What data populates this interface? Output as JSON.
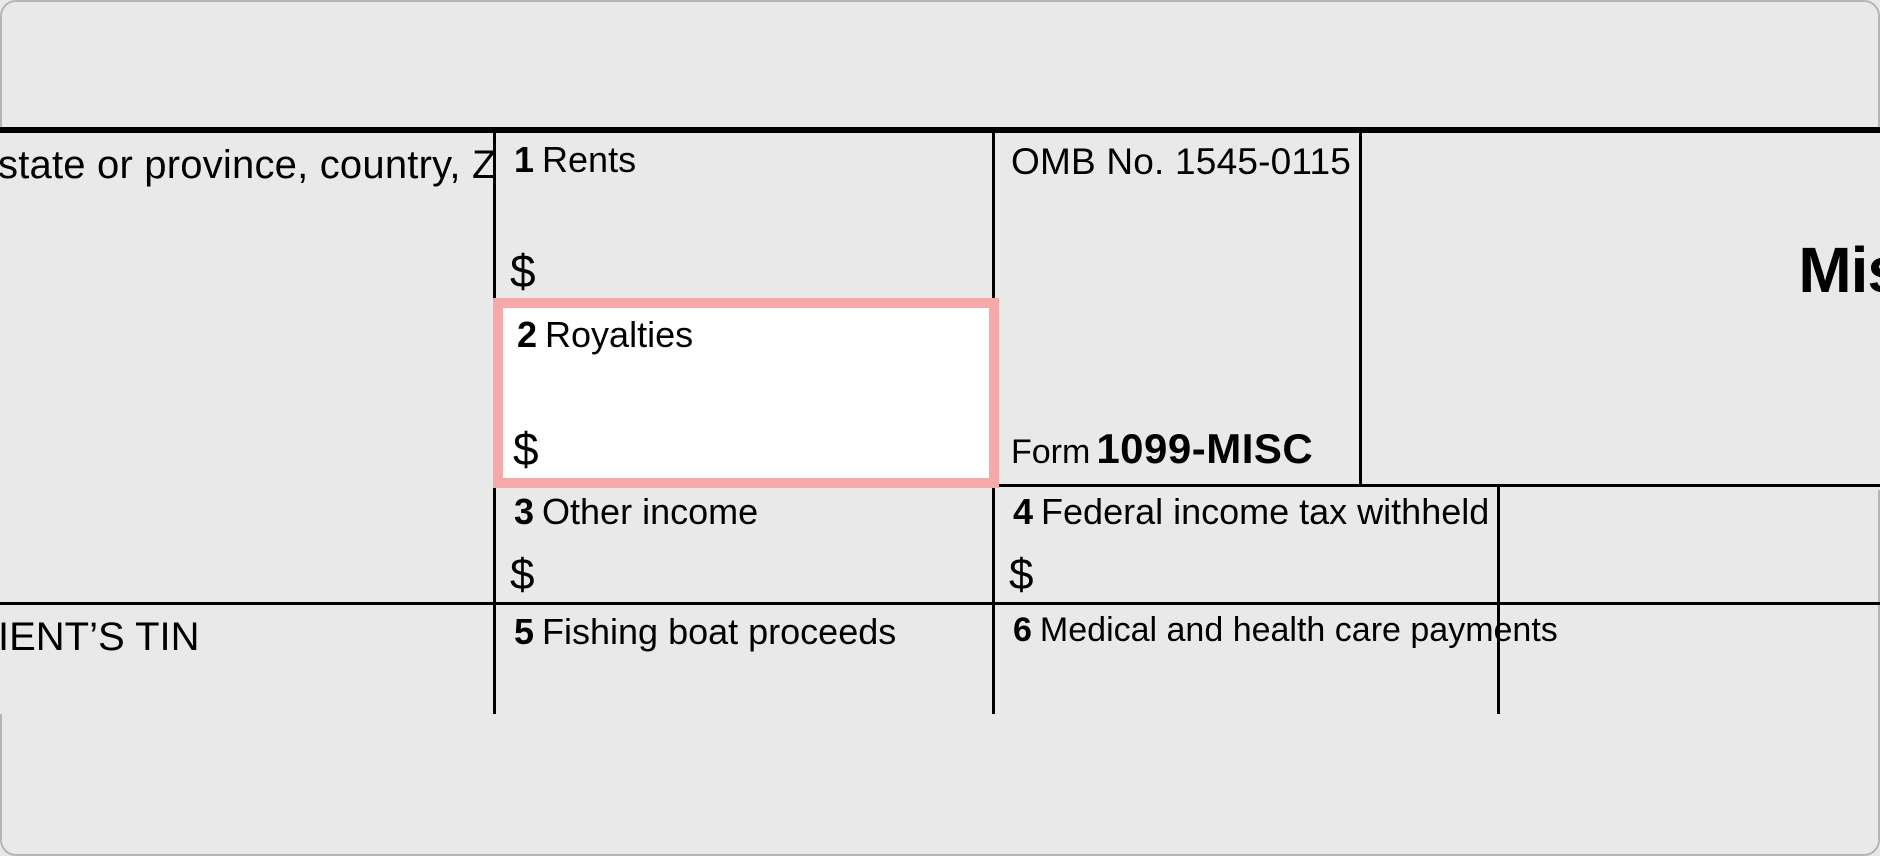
{
  "address_fragment": "state or province, country, ZIP",
  "boxes": {
    "b1": {
      "num": "1",
      "label": "Rents",
      "dollar": "$"
    },
    "b2": {
      "num": "2",
      "label": "Royalties",
      "dollar": "$"
    },
    "b3": {
      "num": "3",
      "label": "Other income",
      "dollar": "$"
    },
    "b4": {
      "num": "4",
      "label": "Federal income tax withheld",
      "dollar": "$"
    },
    "b5": {
      "num": "5",
      "label": "Fishing boat proceeds"
    },
    "b6": {
      "num": "6",
      "label": "Medical and health care payments"
    }
  },
  "omb": {
    "label": "OMB No. 1545-0115",
    "form_prefix": "Form",
    "form_number": "1099-MISC"
  },
  "right_title_fragment": "Mis",
  "tin_fragment": "IENT’S TIN"
}
